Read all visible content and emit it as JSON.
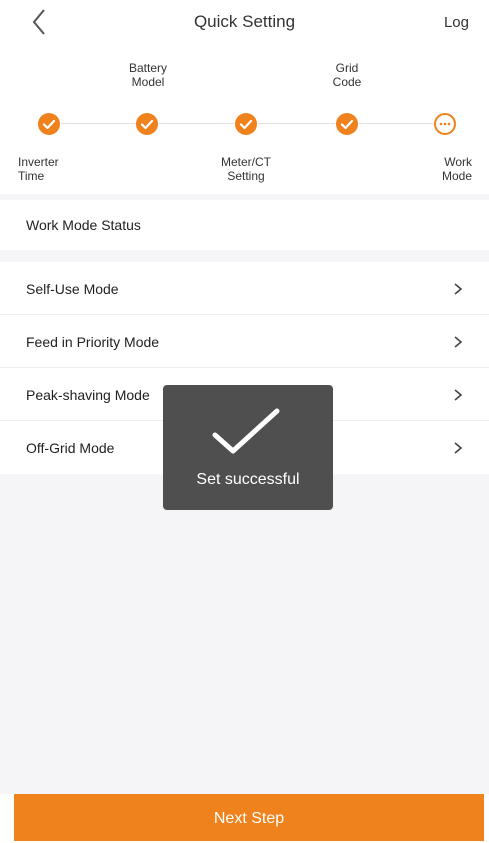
{
  "header": {
    "title": "Quick Setting",
    "log_label": "Log",
    "back_icon": "chevron-left-icon"
  },
  "stepper": {
    "steps": [
      {
        "label": "Inverter\nTime",
        "position": "bottom",
        "state": "done"
      },
      {
        "label": "Battery\nModel",
        "position": "top",
        "state": "done"
      },
      {
        "label": "Meter/CT\nSetting",
        "position": "bottom",
        "state": "done"
      },
      {
        "label": "Grid\nCode",
        "position": "top",
        "state": "done"
      },
      {
        "label": "Work\nMode",
        "position": "bottom",
        "state": "current"
      }
    ]
  },
  "status": {
    "label": "Work Mode Status"
  },
  "modes": [
    {
      "label": "Self-Use Mode"
    },
    {
      "label": "Feed in Priority Mode"
    },
    {
      "label": "Peak-shaving Mode"
    },
    {
      "label": "Off-Grid Mode"
    }
  ],
  "toast": {
    "text": "Set successful",
    "icon": "checkmark-icon"
  },
  "footer": {
    "next_label": "Next Step"
  },
  "colors": {
    "accent": "#f0821e",
    "background": "#f5f5f7",
    "toast_bg": "#404040"
  }
}
